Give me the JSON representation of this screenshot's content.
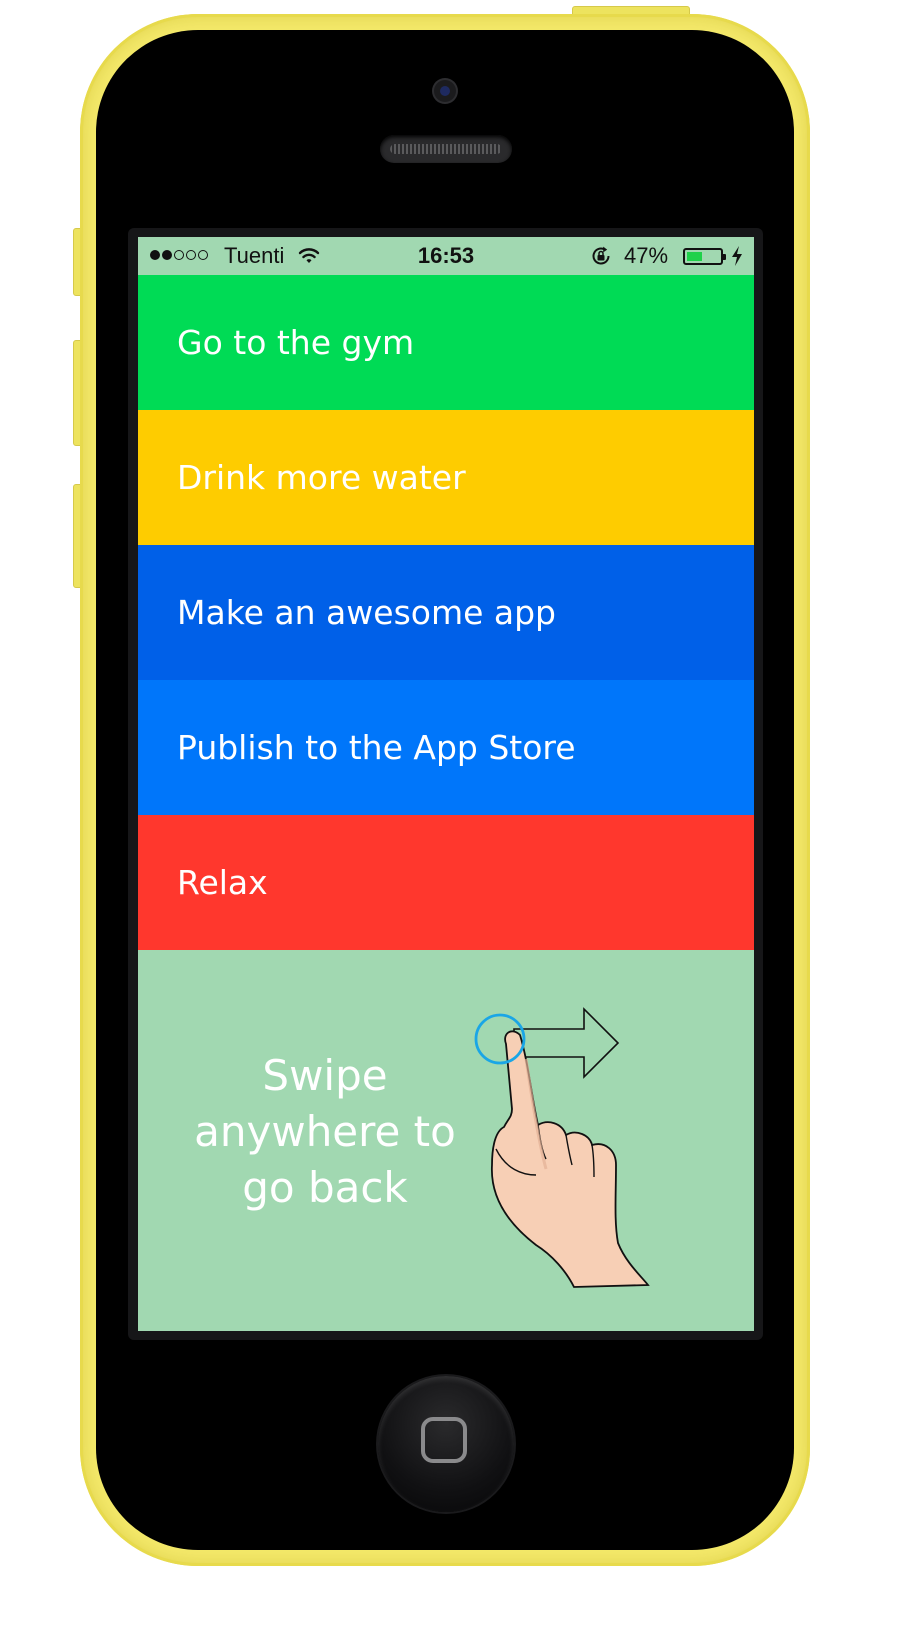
{
  "status_bar": {
    "carrier": "Tuenti",
    "time": "16:53",
    "battery_percent": "47%",
    "battery_level": 0.47,
    "signal_bars_filled": 2,
    "signal_bars_total": 5
  },
  "tasks": [
    {
      "label": "Go to the gym",
      "color": "#00db55"
    },
    {
      "label": "Drink more water",
      "color": "#fecc00"
    },
    {
      "label": "Make an awesome app",
      "color": "#0060e8"
    },
    {
      "label": "Publish to the App Store",
      "color": "#0076fa"
    },
    {
      "label": "Relax",
      "color": "#ff372d"
    }
  ],
  "hint": {
    "line1": "Swipe",
    "line2": "anywhere to",
    "line3": "go back"
  },
  "colors": {
    "screen_background": "#a1d8b1",
    "phone_shell": "#f4e96a",
    "touch_ring": "#1aa6e6"
  }
}
